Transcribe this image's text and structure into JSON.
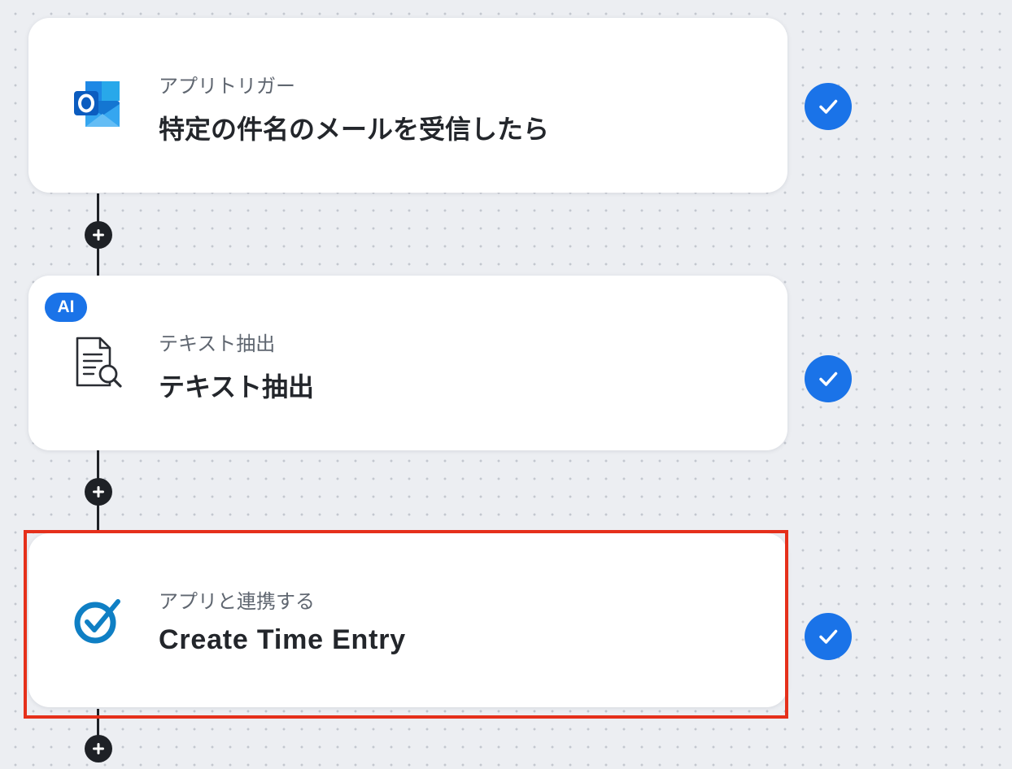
{
  "steps": [
    {
      "subtitle": "アプリトリガー",
      "title": "特定の件名のメールを受信したら",
      "icon": "outlook-icon",
      "status": "completed"
    },
    {
      "badge": "AI",
      "subtitle": "テキスト抽出",
      "title": "テキスト抽出",
      "icon": "document-search-icon",
      "status": "completed"
    },
    {
      "subtitle": "アプリと連携する",
      "title": "Create Time Entry",
      "icon": "time-tracker-check-icon",
      "status": "completed",
      "highlighted": true
    }
  ],
  "colors": {
    "accent": "#1a73e8",
    "highlight": "#e5301b",
    "connector": "#1e2126",
    "canvas": "#eceef2"
  }
}
